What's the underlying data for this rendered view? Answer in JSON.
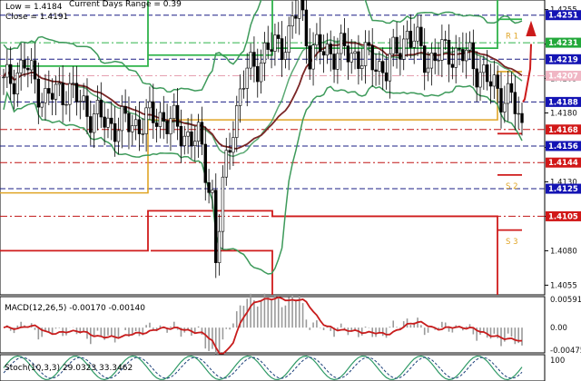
{
  "chart_data": [
    {
      "type": "candlestick",
      "header": {
        "low": "Low = 1.4184",
        "current_days_range": "Current Days Range = 0.39",
        "close": "Close = 1.4191"
      },
      "y_ticks": [
        1.4255,
        1.423,
        1.4205,
        1.418,
        1.4155,
        1.413,
        1.4105,
        1.408,
        1.4055
      ],
      "y_tick_labels": [
        "1.4255",
        "1.4230",
        "1.4205",
        "1.4180",
        "1.4155",
        "1.4130",
        "1.4105",
        "1.4080",
        "1.4055"
      ],
      "ylim": [
        1.4048,
        1.4262
      ],
      "level_tags": [
        {
          "value": 1.4251,
          "label": "1.4251",
          "color": "#1414b4"
        },
        {
          "value": 1.4231,
          "label": "1.4231",
          "color": "#22a83a"
        },
        {
          "value": 1.4219,
          "label": "1.4219",
          "color": "#1414b4"
        },
        {
          "value": 1.4207,
          "label": "1.4207",
          "color": "#f0b6c4"
        },
        {
          "value": 1.4188,
          "label": "1.4188",
          "color": "#1414b4"
        },
        {
          "value": 1.4168,
          "label": "1.4168",
          "color": "#d11818"
        },
        {
          "value": 1.4156,
          "label": "1.4156",
          "color": "#1414b4"
        },
        {
          "value": 1.4144,
          "label": "1.4144",
          "color": "#d11818"
        },
        {
          "value": 1.4125,
          "label": "1.4125",
          "color": "#1414b4"
        },
        {
          "value": 1.4105,
          "label": "1.4105",
          "color": "#d11818"
        }
      ],
      "pivot_labels": [
        {
          "label": "R 1",
          "value": 1.4236
        },
        {
          "label": "S 2",
          "value": 1.4127
        },
        {
          "label": "S 3",
          "value": 1.4087
        }
      ],
      "colors": {
        "bollinger": "#3d9a5a",
        "moving_average": "#7a2626",
        "resistance": "#2fb34a",
        "support": "#cf1b1b",
        "pivot": "#e0a526",
        "level_line": "#1b1f86",
        "arrow": "#cc1a1a"
      },
      "grid": false,
      "legend": "none"
    },
    {
      "type": "histogram+line",
      "title": "MACD(12,26,5) -0.00170 -0.00140",
      "y_ticks": [
        0.00591,
        0.0,
        -0.00475
      ],
      "y_tick_labels": [
        "0.00591",
        "0.00",
        "-0.00475"
      ],
      "ylim": [
        -0.0053,
        0.0065
      ]
    },
    {
      "type": "line",
      "title": "Stoch(10,3,3) 29.0323 33.3462",
      "y_ticks": [
        100
      ],
      "y_tick_labels": [
        "100"
      ],
      "ylim": [
        0,
        100
      ]
    }
  ]
}
